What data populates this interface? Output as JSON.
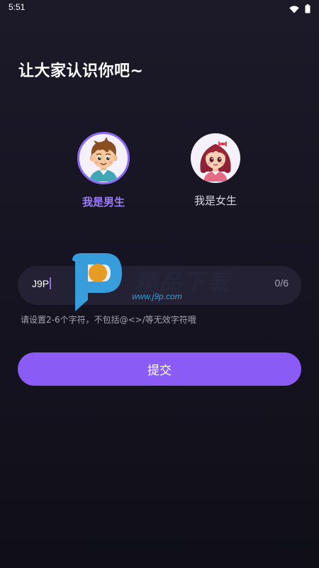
{
  "status_bar": {
    "time": "5:51",
    "icons": [
      "wifi-icon",
      "battery-icon"
    ]
  },
  "page": {
    "title": "让大家认识你吧~"
  },
  "gender": {
    "options": [
      {
        "label": "我是男生",
        "selected": true,
        "avatar": "boy-avatar"
      },
      {
        "label": "我是女生",
        "selected": false,
        "avatar": "girl-avatar"
      }
    ]
  },
  "name_input": {
    "value": "J9P",
    "counter": "0/6"
  },
  "hint": "请设置2-6个字符，不包括@<>/等无效字符哦",
  "submit": {
    "label": "提交"
  },
  "watermark": {
    "brand": "精品下载",
    "url": "www.j9p.com"
  },
  "colors": {
    "accent": "#8a5cf5",
    "selected_label": "#9b7ef2",
    "background": "#151320",
    "input_background": "#232133"
  }
}
